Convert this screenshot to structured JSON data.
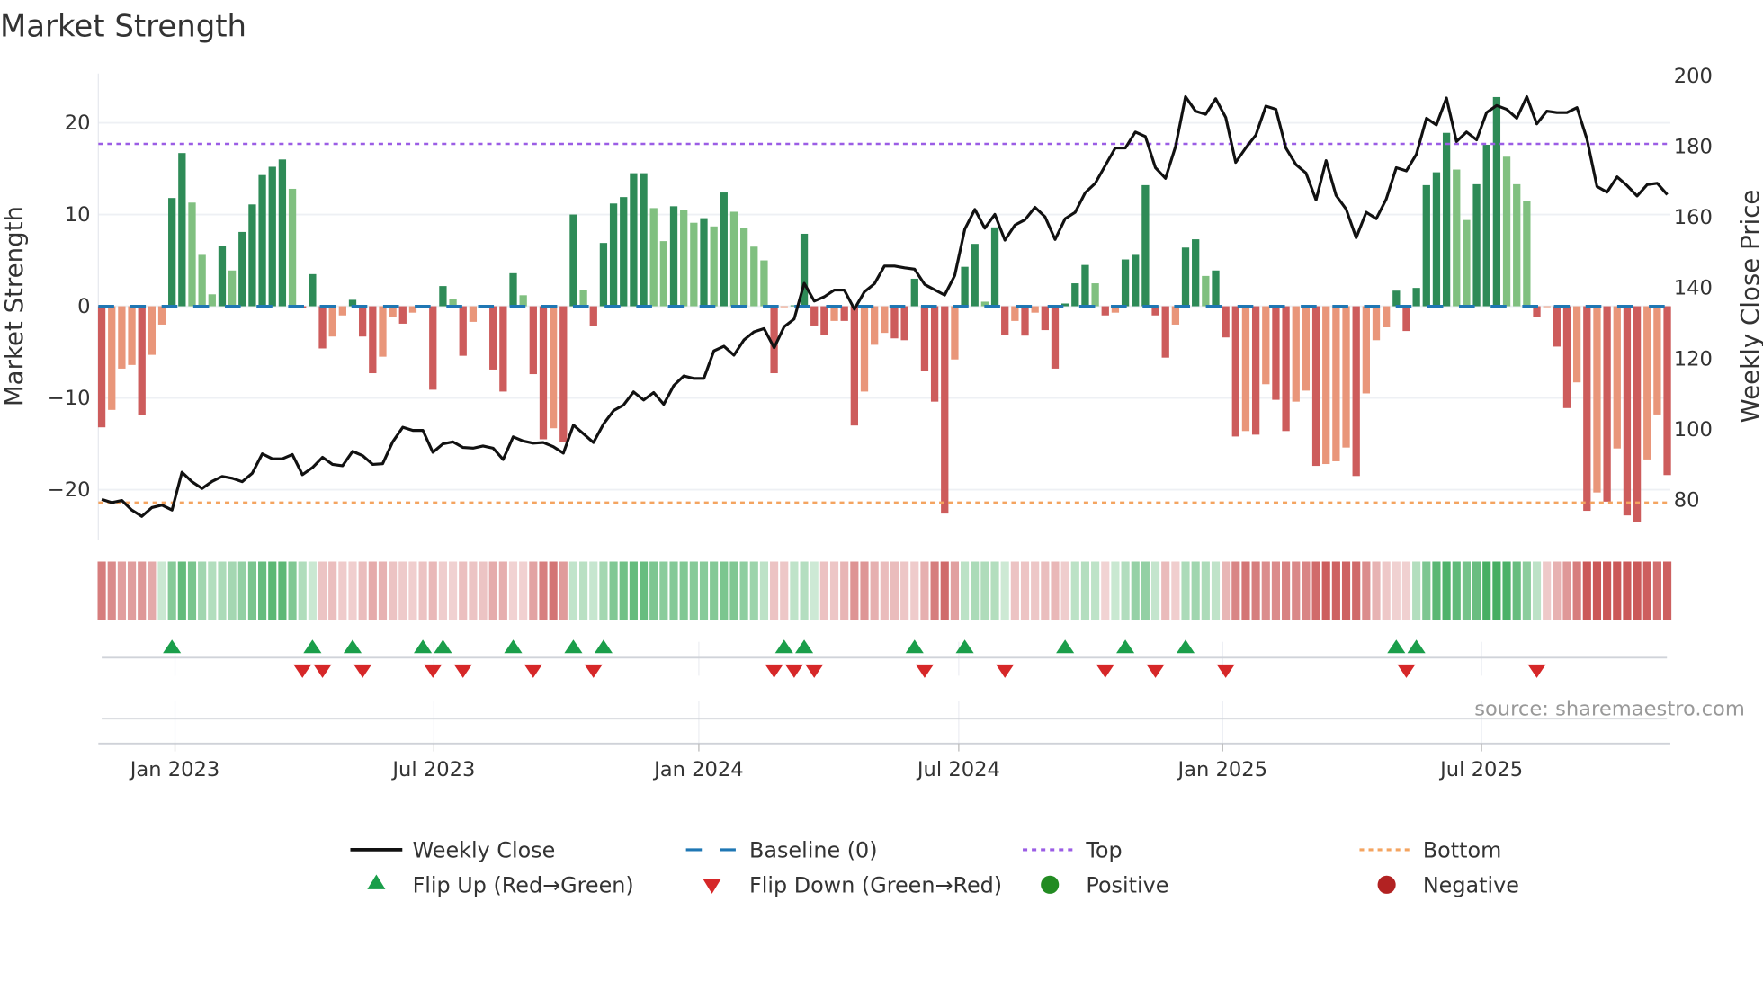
{
  "chart_data": {
    "type": "bar",
    "title": "Market Strength",
    "ylabel": "Market Strength",
    "y2label": "Weekly Close Price",
    "ylim": [
      -25.5,
      25.4
    ],
    "y2lim": [
      68.7,
      200.6
    ],
    "yticks": [
      {
        "v": 20,
        "label": "20"
      },
      {
        "v": 10,
        "label": "10"
      },
      {
        "v": 0,
        "label": "0"
      },
      {
        "v": -10,
        "label": "−10"
      },
      {
        "v": -20,
        "label": "−20"
      }
    ],
    "y2ticks": [
      {
        "v": 200,
        "label": "200"
      },
      {
        "v": 180,
        "label": "180"
      },
      {
        "v": 160,
        "label": "160"
      },
      {
        "v": 140,
        "label": "140"
      },
      {
        "v": 120,
        "label": "120"
      },
      {
        "v": 100,
        "label": "100"
      },
      {
        "v": 80,
        "label": "80"
      }
    ],
    "xticks": [
      {
        "week": 7.3,
        "label": "Jan 2023"
      },
      {
        "week": 33.1,
        "label": "Jul 2023"
      },
      {
        "week": 59.5,
        "label": "Jan 2024"
      },
      {
        "week": 85.4,
        "label": "Jul 2024"
      },
      {
        "week": 111.7,
        "label": "Jan 2025"
      },
      {
        "week": 137.5,
        "label": "Jul 2025"
      }
    ],
    "top_level": 17.7,
    "bottom_level": -21.4,
    "baseline": 0,
    "strength": [
      -13.2,
      -11.3,
      -6.8,
      -6.4,
      -11.9,
      -5.3,
      -2.0,
      11.8,
      16.7,
      11.3,
      5.6,
      1.3,
      6.6,
      3.9,
      8.1,
      11.1,
      14.3,
      15.2,
      16.0,
      12.8,
      -0.2,
      3.5,
      -4.6,
      -3.3,
      -1.0,
      0.7,
      -3.3,
      -7.3,
      -5.5,
      -1.2,
      -1.9,
      -0.7,
      0.1,
      -9.1,
      2.2,
      0.8,
      -5.4,
      -1.7,
      -0.2,
      -6.9,
      -9.3,
      3.6,
      1.2,
      -7.4,
      -14.5,
      -13.3,
      -14.8,
      10.0,
      1.8,
      -2.2,
      6.9,
      11.2,
      11.9,
      14.5,
      14.5,
      10.7,
      7.1,
      10.9,
      10.5,
      9.1,
      9.6,
      8.7,
      12.4,
      10.3,
      8.5,
      6.5,
      5.0,
      -7.3,
      -0.1,
      0.1,
      7.9,
      -2.1,
      -3.1,
      -1.6,
      -1.6,
      -13.0,
      -9.3,
      -4.2,
      -2.9,
      -3.5,
      -3.7,
      3.0,
      -7.1,
      -10.4,
      -22.6,
      -5.8,
      4.3,
      6.8,
      0.5,
      8.6,
      -3.1,
      -1.6,
      -3.2,
      -0.7,
      -2.6,
      -6.8,
      0.3,
      2.5,
      4.5,
      2.5,
      -1.0,
      -0.7,
      5.1,
      5.6,
      13.2,
      -1.0,
      -5.6,
      -2.0,
      6.4,
      7.3,
      3.3,
      3.9,
      -3.4,
      -14.2,
      -13.6,
      -14.0,
      -8.5,
      -10.2,
      -13.6,
      -10.4,
      -9.2,
      -17.4,
      -17.2,
      -16.9,
      -15.4,
      -18.5,
      -9.5,
      -3.7,
      -2.3,
      1.7,
      -2.7,
      2.0,
      13.2,
      14.6,
      18.9,
      14.9,
      9.4,
      13.3,
      17.6,
      22.8,
      16.3,
      13.3,
      11.5,
      -1.2,
      -0.1,
      -4.4,
      -11.1,
      -8.3,
      -22.3,
      -20.3,
      -21.3,
      -15.5,
      -22.8,
      -23.5,
      -16.7,
      -11.8,
      -18.4
    ],
    "weekly_close": [
      80.2,
      79.3,
      79.9,
      77.2,
      75.4,
      77.9,
      78.6,
      77.2,
      87.9,
      85.2,
      83.3,
      85.3,
      86.7,
      86.2,
      85.2,
      87.6,
      93.1,
      91.7,
      91.7,
      92.9,
      87.2,
      89.2,
      92.1,
      90.1,
      89.7,
      93.8,
      92.6,
      90.1,
      90.3,
      96.5,
      100.6,
      99.7,
      99.7,
      93.5,
      95.9,
      96.5,
      94.9,
      94.7,
      95.3,
      94.7,
      91.5,
      97.9,
      96.7,
      96.1,
      96.3,
      95.1,
      93.3,
      101.2,
      98.8,
      96.3,
      101.5,
      105.3,
      106.9,
      110.6,
      108.3,
      110.4,
      107.1,
      112.4,
      115.1,
      114.4,
      114.4,
      122.2,
      123.5,
      121.0,
      125.3,
      127.6,
      128.5,
      123.1,
      129.0,
      131.2,
      141.3,
      136.3,
      137.5,
      139.4,
      139.4,
      134.0,
      138.9,
      141.2,
      146.2,
      146.2,
      145.7,
      145.3,
      141.0,
      139.5,
      138.0,
      143.5,
      156.6,
      162.2,
      156.9,
      160.8,
      153.5,
      157.8,
      159.3,
      162.8,
      160.1,
      153.7,
      159.6,
      161.4,
      166.9,
      169.6,
      174.6,
      179.6,
      179.6,
      184.1,
      182.8,
      174.0,
      171.0,
      180.0,
      194.1,
      190.0,
      189.1,
      193.5,
      188.2,
      175.5,
      179.6,
      183.2,
      191.4,
      190.5,
      179.6,
      174.9,
      172.5,
      164.9,
      176.0,
      166.2,
      162.3,
      154.2,
      161.4,
      159.6,
      165.1,
      174.0,
      173.1,
      177.8,
      188.0,
      186.1,
      193.7,
      181.4,
      184.1,
      181.9,
      189.6,
      191.6,
      190.5,
      188.0,
      194.1,
      186.4,
      190.0,
      189.6,
      189.6,
      191.0,
      182.1,
      168.7,
      167.1,
      171.4,
      168.9,
      166.0,
      169.2,
      169.6,
      166.4
    ],
    "flip_up_weeks": [
      7,
      21,
      25,
      32,
      34,
      41,
      47,
      50,
      68,
      70,
      81,
      86,
      96,
      102,
      108,
      129,
      131
    ],
    "flip_down_weeks": [
      20,
      22,
      26,
      33,
      36,
      43,
      49,
      67,
      69,
      71,
      82,
      90,
      100,
      105,
      112,
      130,
      143
    ],
    "legend": {
      "placement": "bottom",
      "weekly_close": "Weekly Close",
      "baseline": "Baseline (0)",
      "top": "Top",
      "bottom": "Bottom",
      "flip_up": "Flip Up (Red→Green)",
      "flip_down": "Flip Down (Green→Red)",
      "positive": "Positive",
      "negative": "Negative"
    },
    "source": "source: sharemaestro.com"
  },
  "colors": {
    "pos_strong": "#2e8b57",
    "pos_weak": "#80c080",
    "neg_strong": "#cd5c5c",
    "neg_weak": "#e9967a",
    "baseline": "#1f77b4",
    "top": "#9b5de5",
    "bottom": "#f4a460",
    "flip_up": "#1a9e4a",
    "flip_down": "#d62728",
    "positive": "#228b22",
    "negative": "#b22222"
  }
}
